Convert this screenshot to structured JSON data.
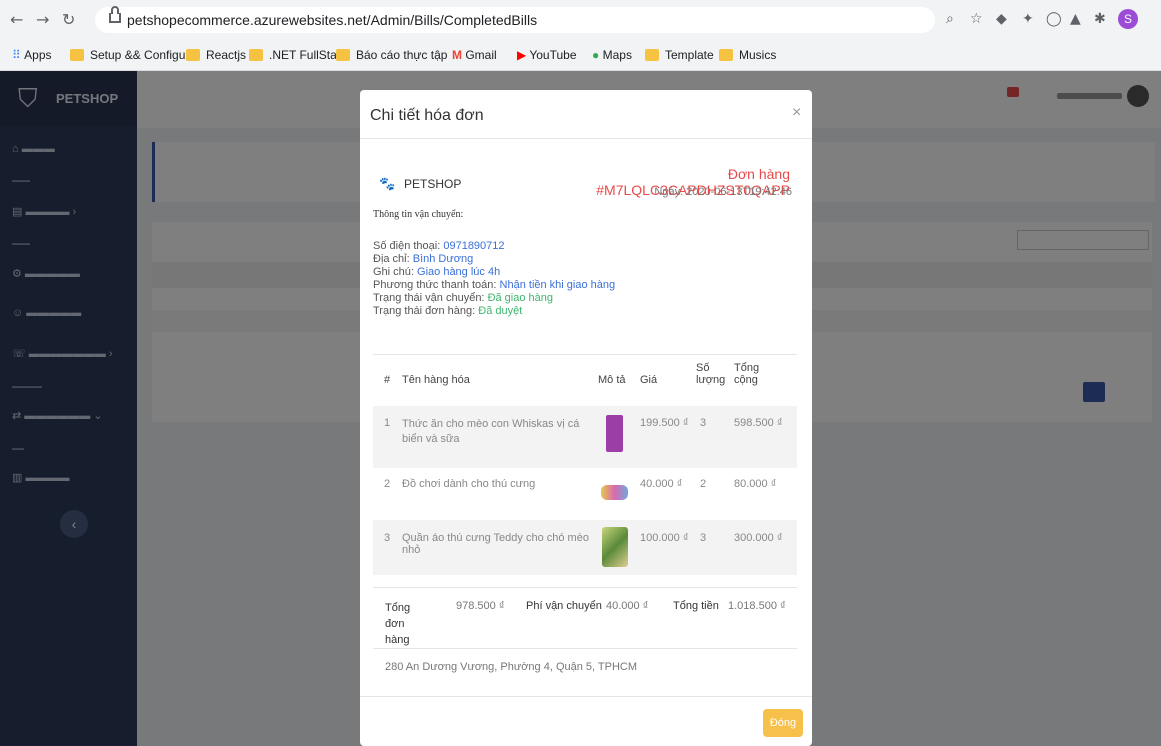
{
  "browser": {
    "url": "petshopecommerce.azurewebsites.net/Admin/Bills/CompletedBills",
    "bookmarks": [
      "Apps",
      "Setup && Configur...",
      "Reactjs",
      ".NET FullStack",
      "Báo cáo thực tập",
      "Gmail",
      "YouTube",
      "Maps",
      "Template",
      "Musics"
    ],
    "profile_initial": "S"
  },
  "sidebar": {
    "brand": "PETSHOP"
  },
  "colors": {
    "accent": "#3a58a8",
    "danger": "#e84a4a",
    "link": "#3a6fd8",
    "success": "#3fb56f",
    "warning": "#f7c04a"
  },
  "modal": {
    "title": "Chi tiết hóa đơn",
    "close_symbol": "×",
    "shop_name": "PETSHOP",
    "order_id": "Đơn hàng #M7LQLC3CAPDHZST0QAPP",
    "order_date": "Ngày: 2020-06-13T19:42:46",
    "shipping_heading": "Thông tin vận chuyển:",
    "info": [
      {
        "label": "Số điện thoại: ",
        "value": "0971890712",
        "style": "v"
      },
      {
        "label": "Địa chỉ: ",
        "value": "Bình Dương",
        "style": "v"
      },
      {
        "label": "Ghi chú: ",
        "value": "Giao hàng lúc 4h",
        "style": "v"
      },
      {
        "label": "Phương thức thanh toán: ",
        "value": "Nhận tiền khi giao hàng",
        "style": "v"
      },
      {
        "label": "Trạng thái vận chuyển: ",
        "value": "Đã giao hàng",
        "style": "g"
      },
      {
        "label": "Trạng thái đơn hàng: ",
        "value": "Đã duyệt",
        "style": "g"
      }
    ],
    "table_headers": {
      "index": "#",
      "name": "Tên hàng hóa",
      "desc": "Mô tả",
      "price": "Giá",
      "qty": "Số lượng",
      "total": "Tổng cộng"
    },
    "items": [
      {
        "index": "1",
        "name": "Thức ăn cho mèo con Whiskas vị cá biển và sữa",
        "price": "199.500 ₫",
        "qty": "3",
        "total": "598.500 ₫"
      },
      {
        "index": "2",
        "name": "Đồ chơi dành cho thú cưng",
        "price": "40.000 ₫",
        "qty": "2",
        "total": "80.000 ₫"
      },
      {
        "index": "3",
        "name": "Quần áo thú cưng Teddy cho chó mèo nhỏ",
        "price": "100.000 ₫",
        "qty": "3",
        "total": "300.000 ₫"
      }
    ],
    "totals": {
      "subtotal_label": "Tổng đơn hàng",
      "subtotal_value": "978.500 ₫",
      "shipping_label": "Phí vận chuyển",
      "shipping_value": "40.000 ₫",
      "grand_label": "Tổng tiền",
      "grand_value": "1.018.500 ₫"
    },
    "address": "280 An Dương Vương, Phường 4, Quận 5, TPHCM",
    "close_button": "Đóng"
  }
}
